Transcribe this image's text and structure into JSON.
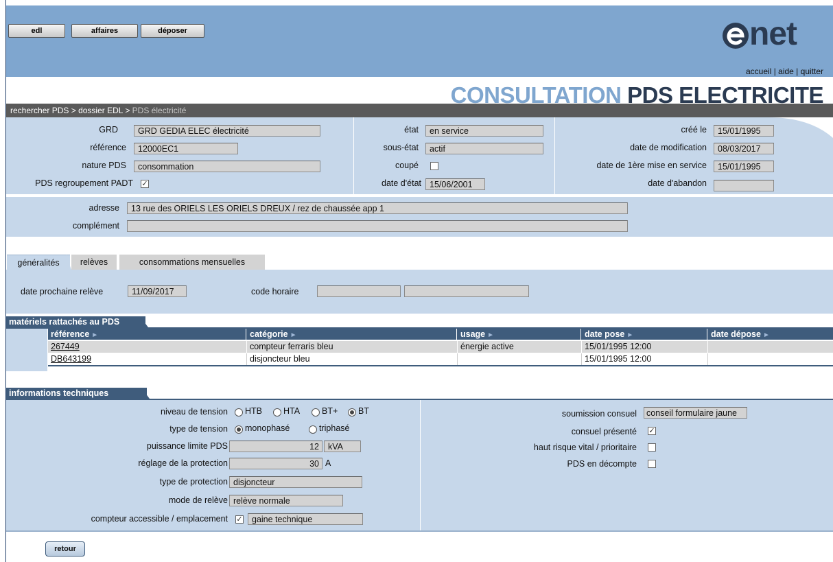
{
  "nav": {
    "edl": "edl",
    "affaires": "affaires",
    "deposer": "déposer"
  },
  "logo": {
    "text": "net"
  },
  "toplinks": {
    "accueil": "accueil",
    "sep1": " | ",
    "aide": "aide",
    "sep2": " | ",
    "quitter": "quitter"
  },
  "title": {
    "part1": "CONSULTATION ",
    "part2": "PDS ELECTRICITE"
  },
  "breadcrumb": {
    "item1": "rechercher PDS",
    "sep": " > ",
    "item2": "dossier EDL",
    "item3": "PDS électricité"
  },
  "info": {
    "grd_label": "GRD",
    "grd_value": "GRD GEDIA ELEC électricité",
    "reference_label": "référence",
    "reference_value": "12000EC1",
    "nature_label": "nature PDS",
    "nature_value": "consommation",
    "padt_label": "PDS regroupement PADT",
    "padt_checked": "✓",
    "etat_label": "état",
    "etat_value": "en service",
    "sousetat_label": "sous-état",
    "sousetat_value": "actif",
    "coupe_label": "coupé",
    "dateetat_label": "date d'état",
    "dateetat_value": "15/06/2001",
    "cree_label": "créé le",
    "cree_value": "15/01/1995",
    "datemodif_label": "date de modification",
    "datemodif_value": "08/03/2017",
    "datemes_label": "date de 1ère mise en service",
    "datemes_value": "15/01/1995",
    "dateabandon_label": "date d'abandon",
    "dateabandon_value": ""
  },
  "address": {
    "adresse_label": "adresse",
    "adresse_value": "13 rue des ORIELS LES ORIELS DREUX / rez de chaussée app 1",
    "complement_label": "complément",
    "complement_value": ""
  },
  "tabs": [
    {
      "label": "généralités"
    },
    {
      "label": "relèves"
    },
    {
      "label": "consommations mensuelles"
    }
  ],
  "general": {
    "prochaine_label": "date prochaine relève",
    "prochaine_value": "11/09/2017",
    "codehoraire_label": "code horaire",
    "codehoraire_value1": "",
    "codehoraire_value2": ""
  },
  "materiels": {
    "header": "matériels rattachés au PDS",
    "columns": [
      "référence",
      "catégorie",
      "usage",
      "date pose",
      "date dépose"
    ],
    "rows": [
      {
        "reference": "267449",
        "categorie": "compteur ferraris bleu",
        "usage": "énergie active",
        "date_pose": "15/01/1995 12:00",
        "date_depose": ""
      },
      {
        "reference": "DB643199",
        "categorie": "disjoncteur bleu",
        "usage": "",
        "date_pose": "15/01/1995 12:00",
        "date_depose": ""
      }
    ]
  },
  "tech": {
    "header": "informations techniques",
    "niveau_label": "niveau de tension",
    "niveau_options": [
      "HTB",
      "HTA",
      "BT+",
      "BT"
    ],
    "niveau_selected": "BT",
    "type_label": "type de tension",
    "type_options": [
      "monophasé",
      "triphasé"
    ],
    "type_selected": "monophasé",
    "puissance_label": "puissance limite PDS",
    "puissance_value": "12",
    "puissance_unit": "kVA",
    "reglage_label": "réglage de la protection",
    "reglage_value": "30",
    "reglage_unit": "A",
    "typeprot_label": "type de protection",
    "typeprot_value": "disjoncteur",
    "mode_label": "mode de relève",
    "mode_value": "relève normale",
    "compteur_label": "compteur accessible / emplacement",
    "compteur_checked": "✓",
    "compteur_value": "gaine technique",
    "consuel_sub_label": "soumission consuel",
    "consuel_sub_value": "conseil formulaire jaune",
    "consuel_pres_label": "consuel présenté",
    "consuel_pres_checked": "✓",
    "risque_label": "haut risque vital / prioritaire",
    "decompte_label": "PDS en décompte"
  },
  "retour": "retour",
  "colors": {
    "blue": "#7fa6cf",
    "panel": "#c6d7ea",
    "dark": "#3f5c7c",
    "title_dark": "#2b3b52"
  }
}
